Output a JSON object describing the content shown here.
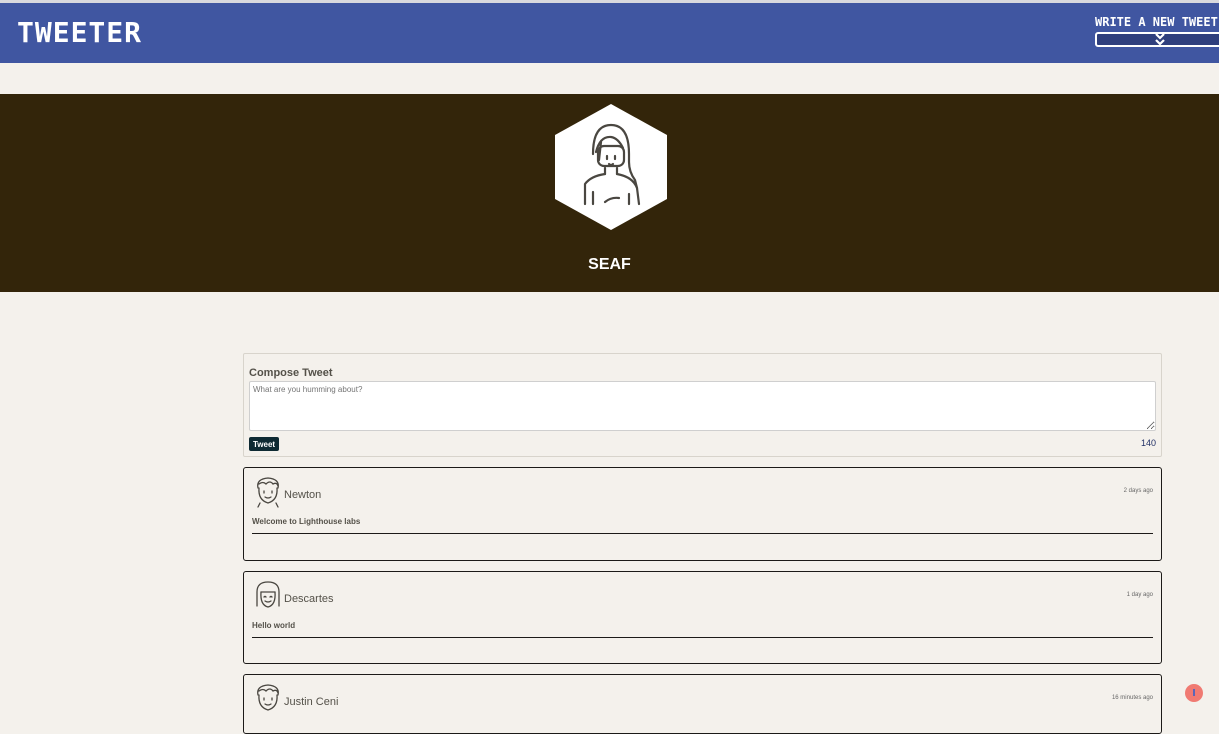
{
  "nav": {
    "brand": "TWEETER",
    "write_label": "WRITE A NEW TWEET"
  },
  "profile": {
    "username": "SEAF"
  },
  "compose": {
    "title": "Compose Tweet",
    "placeholder": "What are you humming about?",
    "button_label": "Tweet",
    "counter": "140"
  },
  "tweets": [
    {
      "name": "Newton",
      "time": "2 days ago",
      "text": "Welcome to Lighthouse labs"
    },
    {
      "name": "Descartes",
      "time": "1 day ago",
      "text": "Hello world"
    },
    {
      "name": "Justin Ceni",
      "time": "16 minutes ago",
      "text": ""
    }
  ],
  "colors": {
    "nav_bg": "#4056a1",
    "hero_bg": "#33250a",
    "page_bg": "#f4f1ec",
    "button_bg": "#0e2a33"
  },
  "icons": {
    "write_toggle": "double-chevron-down-icon",
    "profile_avatar": "profile-avatar-icon",
    "user_avatar": "user-avatar-icon",
    "corner_indicator": "notification-dot-icon"
  }
}
